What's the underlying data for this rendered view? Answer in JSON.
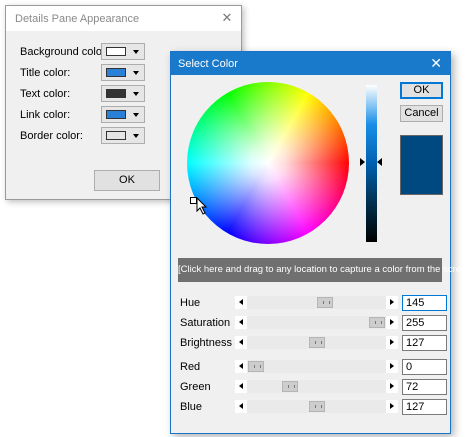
{
  "details_dialog": {
    "title": "Details Pane Appearance",
    "close_glyph": "✕",
    "rows": [
      {
        "label": "Background color:",
        "swatch": "#ffffff"
      },
      {
        "label": "Title color:",
        "swatch": "#2a7fd6"
      },
      {
        "label": "Text color:",
        "swatch": "#333333"
      },
      {
        "label": "Link color:",
        "swatch": "#2a7fd6"
      },
      {
        "label": "Border color:",
        "swatch": "#e5e5e5"
      }
    ],
    "ok_label": "OK"
  },
  "select_color_dialog": {
    "title": "Select Color",
    "close_glyph": "✕",
    "ok_label": "OK",
    "cancel_label": "Cancel",
    "selected_color": "#004880",
    "capture_text": "[Click here and drag to any location to capture a color from the screen]",
    "hsb": [
      {
        "label": "Hue",
        "value": "145",
        "position": 0.57
      },
      {
        "label": "Saturation",
        "value": "255",
        "position": 1.0
      },
      {
        "label": "Brightness",
        "value": "127",
        "position": 0.5
      }
    ],
    "rgb": [
      {
        "label": "Red",
        "value": "0",
        "position": 0.0
      },
      {
        "label": "Green",
        "value": "72",
        "position": 0.28
      },
      {
        "label": "Blue",
        "value": "127",
        "position": 0.5
      }
    ]
  }
}
